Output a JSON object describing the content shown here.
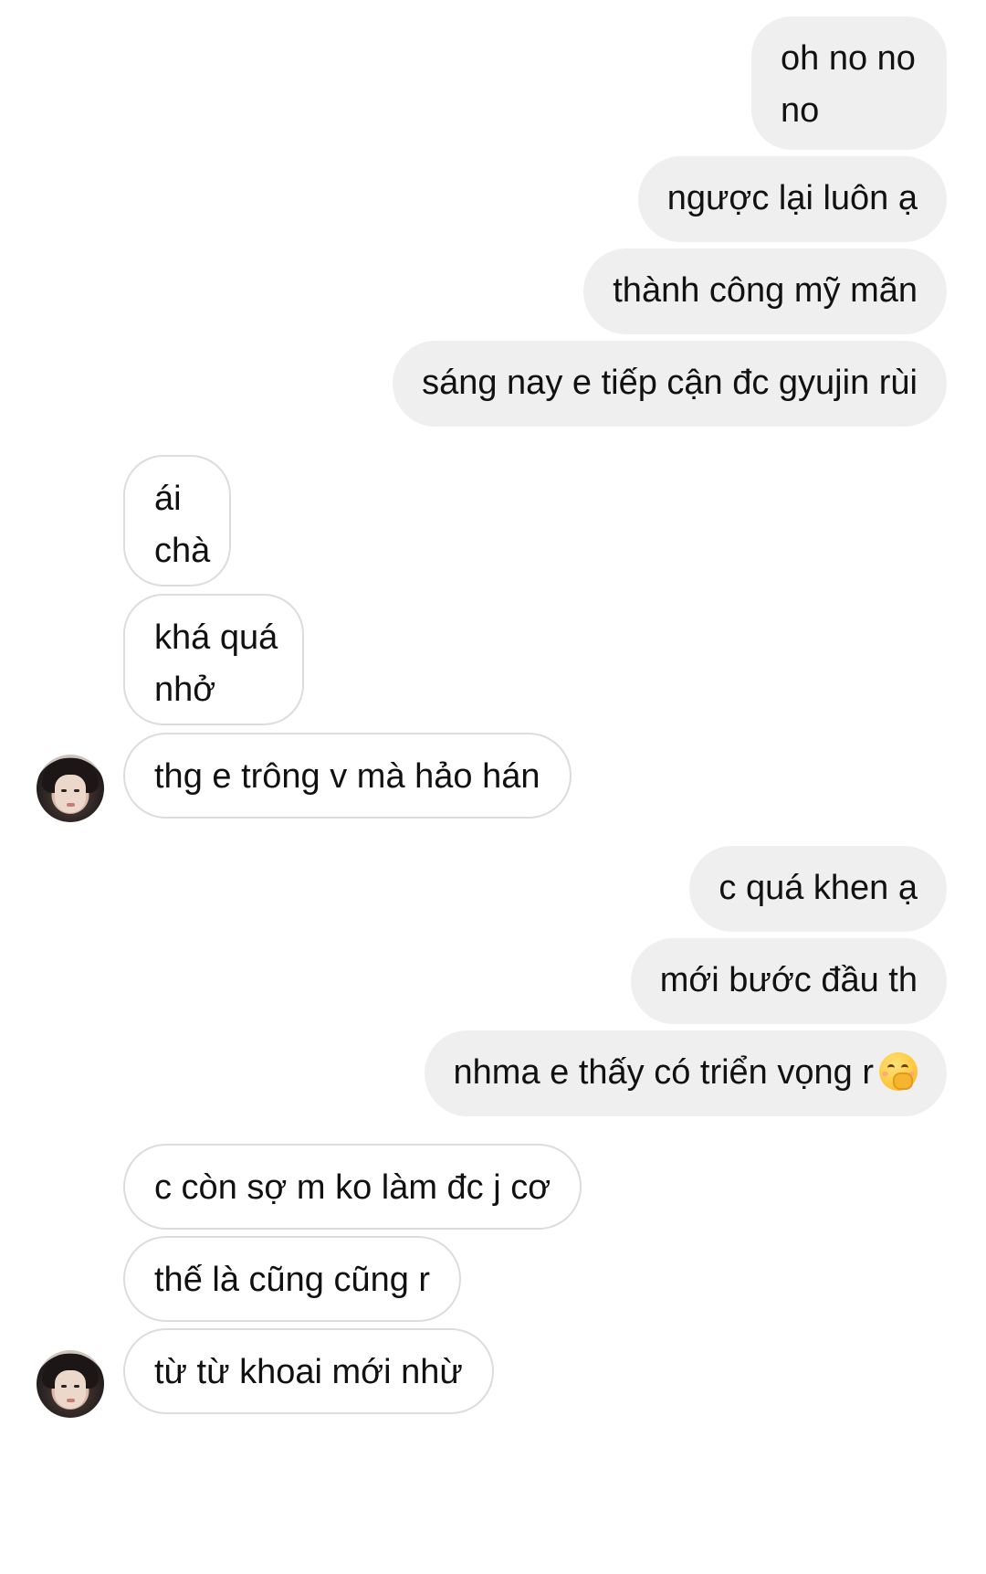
{
  "messages": [
    {
      "side": "out",
      "lines": [
        "oh no no",
        "no"
      ]
    },
    {
      "side": "out",
      "lines": [
        "ngược lại luôn ạ"
      ]
    },
    {
      "side": "out",
      "lines": [
        "thành công mỹ mãn"
      ]
    },
    {
      "side": "out",
      "lines": [
        "sáng nay e tiếp cận đc gyujin rùi"
      ]
    },
    {
      "side": "in",
      "lines": [
        "ái",
        "chà"
      ]
    },
    {
      "side": "in",
      "lines": [
        "khá quá",
        "nhở"
      ]
    },
    {
      "side": "in",
      "lines": [
        "thg e trông v mà hảo hán"
      ]
    },
    {
      "side": "out",
      "lines": [
        "c quá khen ạ"
      ]
    },
    {
      "side": "out",
      "lines": [
        "mới bước đầu th"
      ]
    },
    {
      "side": "out",
      "lines": [
        "nhma e thấy có triển vọng r"
      ],
      "emoji": "face-with-hand-over-mouth"
    },
    {
      "side": "in",
      "lines": [
        "c còn sợ m ko làm đc j cơ"
      ]
    },
    {
      "side": "in",
      "lines": [
        "thế là cũng cũng r"
      ]
    },
    {
      "side": "in",
      "lines": [
        "từ từ khoai mới nhừ"
      ]
    }
  ]
}
